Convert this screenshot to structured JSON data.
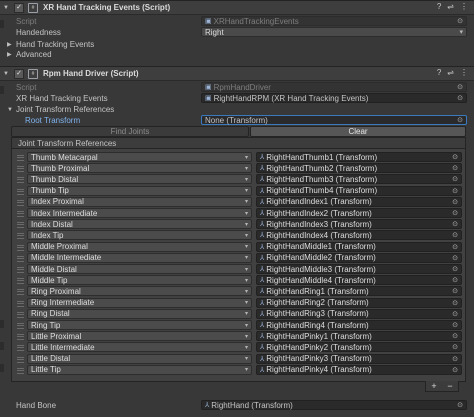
{
  "xr_events": {
    "title": "XR Hand Tracking Events (Script)",
    "script_label": "Script",
    "script_value": "XRHandTrackingEvents",
    "handedness_label": "Handedness",
    "handedness_value": "Right",
    "section_events": "Hand Tracking Events",
    "section_advanced": "Advanced"
  },
  "rpm": {
    "title": "Rpm Hand Driver (Script)",
    "script_label": "Script",
    "script_value": "RpmHandDriver",
    "events_label": "XR Hand Tracking Events",
    "events_value": "RightHandRPM (XR Hand Tracking Events)",
    "jtr_label": "Joint Transform References",
    "root_label": "Root Transform",
    "root_value": "None (Transform)",
    "find_joints": "Find Joints",
    "clear": "Clear",
    "list_header": "Joint Transform References",
    "hand_bone_label": "Hand Bone",
    "hand_bone_value": "RightHand (Transform)"
  },
  "joints": [
    {
      "joint": "Thumb Metacarpal",
      "transform": "RightHandThumb1 (Transform)"
    },
    {
      "joint": "Thumb Proximal",
      "transform": "RightHandThumb2 (Transform)"
    },
    {
      "joint": "Thumb Distal",
      "transform": "RightHandThumb3 (Transform)"
    },
    {
      "joint": "Thumb Tip",
      "transform": "RightHandThumb4 (Transform)"
    },
    {
      "joint": "Index Proximal",
      "transform": "RightHandIndex1 (Transform)"
    },
    {
      "joint": "Index Intermediate",
      "transform": "RightHandIndex2 (Transform)"
    },
    {
      "joint": "Index Distal",
      "transform": "RightHandIndex3 (Transform)"
    },
    {
      "joint": "Index Tip",
      "transform": "RightHandIndex4 (Transform)"
    },
    {
      "joint": "Middle Proximal",
      "transform": "RightHandMiddle1 (Transform)"
    },
    {
      "joint": "Middle Intermediate",
      "transform": "RightHandMiddle2 (Transform)"
    },
    {
      "joint": "Middle Distal",
      "transform": "RightHandMiddle3 (Transform)"
    },
    {
      "joint": "Middle Tip",
      "transform": "RightHandMiddle4 (Transform)"
    },
    {
      "joint": "Ring Proximal",
      "transform": "RightHandRing1 (Transform)"
    },
    {
      "joint": "Ring Intermediate",
      "transform": "RightHandRing2 (Transform)"
    },
    {
      "joint": "Ring Distal",
      "transform": "RightHandRing3 (Transform)"
    },
    {
      "joint": "Ring Tip",
      "transform": "RightHandRing4 (Transform)"
    },
    {
      "joint": "Little Proximal",
      "transform": "RightHandPinky1 (Transform)"
    },
    {
      "joint": "Little Intermediate",
      "transform": "RightHandPinky2 (Transform)"
    },
    {
      "joint": "Little Distal",
      "transform": "RightHandPinky3 (Transform)"
    },
    {
      "joint": "Little Tip",
      "transform": "RightHandPinky4 (Transform)"
    }
  ],
  "icons": {
    "help": "?",
    "presets": "⇌",
    "more": "⋮",
    "checkmark": "✓",
    "object_picker": "⊙",
    "transform": "⅄",
    "plus": "+",
    "minus": "−",
    "fold_open": "▼",
    "fold_closed": "▶",
    "dropdown_arrow": "▾"
  },
  "colors": {
    "background": "#383838",
    "selected_blue": "#3a79bb",
    "root_label": "#7fb2ee"
  }
}
